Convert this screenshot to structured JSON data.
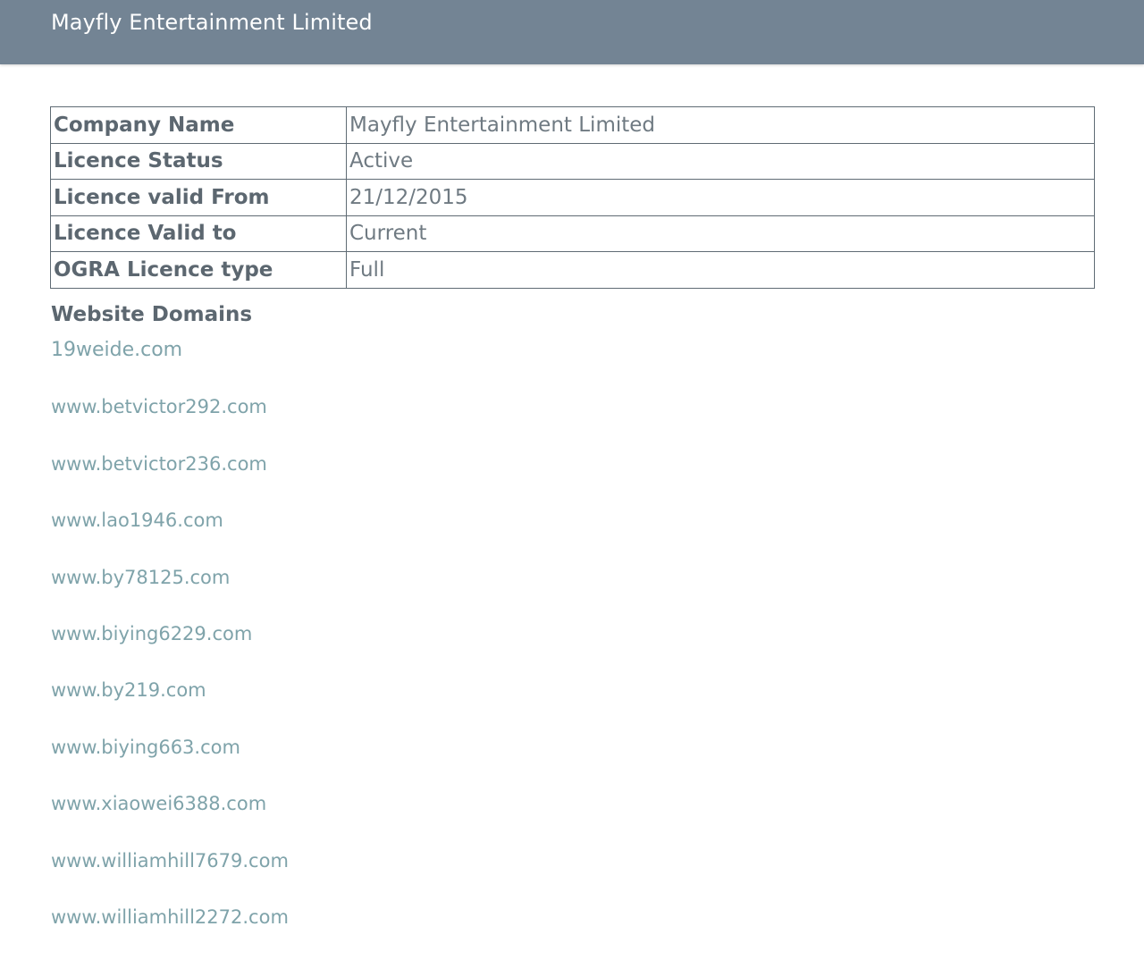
{
  "header": {
    "title": "Mayfly Entertainment Limited"
  },
  "licence_table": {
    "rows": [
      {
        "label": "Company Name",
        "value": "Mayfly Entertainment Limited"
      },
      {
        "label": "Licence Status",
        "value": "Active"
      },
      {
        "label": "Licence valid From",
        "value": "21/12/2015"
      },
      {
        "label": "Licence Valid to",
        "value": "Current"
      },
      {
        "label": "OGRA Licence type",
        "value": "Full"
      }
    ]
  },
  "domains": {
    "heading": "Website Domains",
    "items": [
      "19weide.com",
      "www.betvictor292.com",
      "www.betvictor236.com",
      "www.lao1946.com",
      "www.by78125.com",
      "www.biying6229.com",
      "www.by219.com",
      "www.biying663.com",
      "www.xiaowei6388.com",
      "www.williamhill7679.com",
      "www.williamhill2272.com"
    ]
  },
  "colors": {
    "header_bg": "#738494",
    "header_text": "#ffffff",
    "table_border": "#5f6b74",
    "label_text": "#5c6770",
    "link_text": "#7fa3aa"
  }
}
